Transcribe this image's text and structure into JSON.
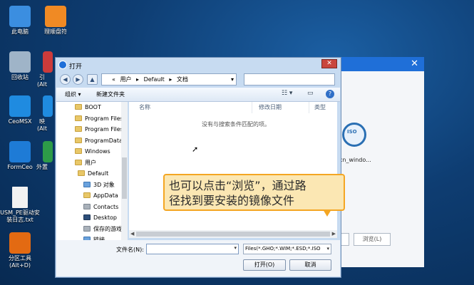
{
  "desktop": {
    "icons": [
      {
        "label": "此电脑",
        "color": "#3b8ee0"
      },
      {
        "label": "理顺盘符",
        "color": "#f08a24"
      },
      {
        "label": "回收站",
        "color": "#9fb4c8"
      },
      {
        "label": "引",
        "color": "#cc3b3b"
      },
      {
        "label": "(Alt",
        "color": "#cc3b3b"
      },
      {
        "label": "CeoMSX",
        "color": "#1f8be0"
      },
      {
        "label": "映",
        "color": "#1f8be0"
      },
      {
        "label": "(Alt",
        "color": "#1f8be0"
      },
      {
        "label": "FormCeo",
        "color": "#1e7bd6"
      },
      {
        "label": "外置",
        "color": "#2d9b48"
      },
      {
        "label": "USM_PE驱动安装日志.txt",
        "color": "#f2f2f2"
      },
      {
        "label": "分区工具(Alt+D)",
        "color": "#e36a12"
      }
    ]
  },
  "bg_app": {
    "disc_label": "ISO",
    "disc_name": "cn_windo...",
    "browse_label": "浏览(L)",
    "close": "✕"
  },
  "dialog": {
    "title": "打开",
    "close": "✕",
    "nav": {
      "back": "◀",
      "forward": "▶",
      "up": "▲"
    },
    "address": [
      "«",
      "用户",
      "▸",
      "Default",
      "▸",
      "文档"
    ],
    "address_dropdown": "▾",
    "toolbar": {
      "organize": "组织 ▾",
      "new_folder": "新建文件夹",
      "view": "☷ ▾",
      "preview": "▭",
      "help": "?"
    },
    "tree": [
      {
        "label": "BOOT",
        "kind": "folder"
      },
      {
        "label": "Program Files",
        "kind": "folder"
      },
      {
        "label": "Program Files",
        "kind": "folder"
      },
      {
        "label": "ProgramData",
        "kind": "folder"
      },
      {
        "label": "Windows",
        "kind": "folder"
      },
      {
        "label": "用户",
        "kind": "folder"
      },
      {
        "label": "Default",
        "kind": "folder"
      },
      {
        "label": "3D 对象",
        "kind": "blue"
      },
      {
        "label": "AppData",
        "kind": "folder"
      },
      {
        "label": "Contacts",
        "kind": "gray"
      },
      {
        "label": "Desktop",
        "kind": "dark"
      },
      {
        "label": "保存的游戏",
        "kind": "gray"
      },
      {
        "label": "链接",
        "kind": "blue"
      }
    ],
    "columns": {
      "name": "名称",
      "modified": "修改日期",
      "type": "类型"
    },
    "empty_message": "没有与搜索条件匹配的项。",
    "filename_label": "文件名(N):",
    "filename_value": "",
    "filetype": "Files(*.GHO;*.WIM;*.ESD;*.ISO",
    "open_button": "打开(O)",
    "cancel_button": "取消"
  },
  "tooltip": {
    "line1": "也可以点击“浏览”，通过路",
    "line2": "径找到要安装的镜像文件"
  }
}
